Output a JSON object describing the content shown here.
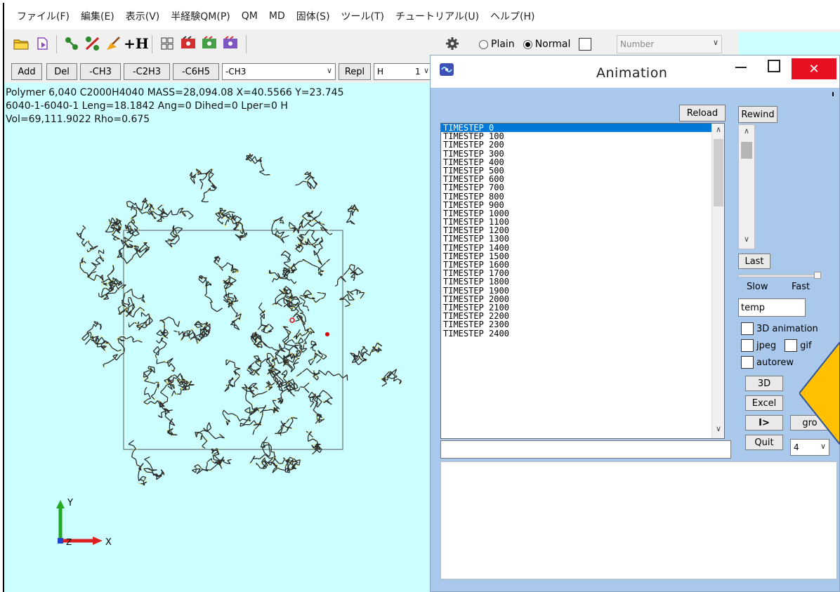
{
  "menu": [
    "ファイル(F)",
    "編集(E)",
    "表示(V)",
    "半経験QM(P)",
    "QM",
    "MD",
    "固体(S)",
    "ツール(T)",
    "チュートリアル(U)",
    "ヘルプ(H)"
  ],
  "toolbar": {
    "hydrogen_label": "+H",
    "display_plain": "Plain",
    "display_normal": "Normal",
    "number_placeholder": "Number"
  },
  "edit_row": {
    "add": "Add",
    "del": "Del",
    "groups": [
      "-CH3",
      "-C2H3",
      "-C6H5"
    ],
    "group_select": "-CH3",
    "repl": "Repl",
    "element_select": "H",
    "count_select": "1"
  },
  "viewer": {
    "info_lines": [
      "Polymer  6,040  C2000H4040  MASS=28,094.08  X=40.5566  Y=23.745",
      "6040-1-6040-1 Leng=18.1842 Ang=0 Dihed=0 Lper=0 H",
      "Vol=69,111.9022 Rho=0.675"
    ],
    "axis_y": "Y",
    "axis_x": "X",
    "axis_z": "Z"
  },
  "animation": {
    "title": "Animation",
    "reload": "Reload",
    "rewind": "Rewind",
    "last": "Last",
    "slow": "Slow",
    "fast": "Fast",
    "filename": "temp",
    "check_3d": "3D animation",
    "check_jpeg": "jpeg",
    "check_gif": "gif",
    "check_autorew": "autorew",
    "btn_3d": "3D",
    "btn_excel": "Excel",
    "btn_play": "I>",
    "btn_gro": "gro",
    "btn_quit": "Quit",
    "select_value": "4",
    "timesteps": [
      "TIMESTEP  0",
      "TIMESTEP  100",
      "TIMESTEP  200",
      "TIMESTEP  300",
      "TIMESTEP  400",
      "TIMESTEP  500",
      "TIMESTEP  600",
      "TIMESTEP  700",
      "TIMESTEP  800",
      "TIMESTEP  900",
      "TIMESTEP  1000",
      "TIMESTEP  1100",
      "TIMESTEP  1200",
      "TIMESTEP  1300",
      "TIMESTEP  1400",
      "TIMESTEP  1500",
      "TIMESTEP  1600",
      "TIMESTEP  1700",
      "TIMESTEP  1800",
      "TIMESTEP  1900",
      "TIMESTEP  2000",
      "TIMESTEP  2100",
      "TIMESTEP  2200",
      "TIMESTEP  2300",
      "TIMESTEP  2400"
    ],
    "selected_index": 0
  },
  "colors": {
    "viewer_bg": "#ccffff",
    "dialog_bg": "#a9c8ec",
    "selection": "#0078d7",
    "close_button": "#e81123",
    "pointer_shape": "#ffc000"
  }
}
